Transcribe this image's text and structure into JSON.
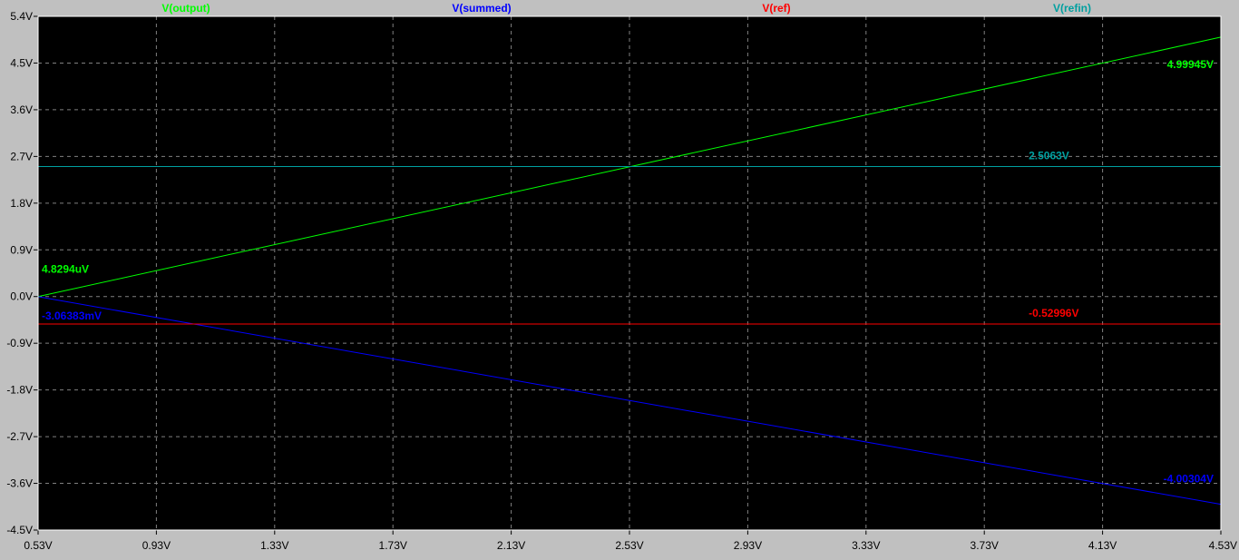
{
  "chart_data": {
    "type": "line",
    "xlabel": "",
    "ylabel": "",
    "xlim": [
      0.53,
      4.53
    ],
    "ylim": [
      -4.5,
      5.4
    ],
    "x_ticks": [
      "0.53V",
      "0.93V",
      "1.33V",
      "1.73V",
      "2.13V",
      "2.53V",
      "2.93V",
      "3.33V",
      "3.73V",
      "4.13V",
      "4.53V"
    ],
    "x_tick_values": [
      0.53,
      0.93,
      1.33,
      1.73,
      2.13,
      2.53,
      2.93,
      3.33,
      3.73,
      4.13,
      4.53
    ],
    "y_ticks": [
      "5.4V",
      "4.5V",
      "3.6V",
      "2.7V",
      "1.8V",
      "0.9V",
      "0.0V",
      "-0.9V",
      "-1.8V",
      "-2.7V",
      "-3.6V",
      "-4.5V"
    ],
    "y_tick_values": [
      5.4,
      4.5,
      3.6,
      2.7,
      1.8,
      0.9,
      0.0,
      -0.9,
      -1.8,
      -2.7,
      -3.6,
      -4.5
    ],
    "grid": true,
    "background": "#000000",
    "axis_color": "#c0c0c0",
    "tick_label_color": "#000000",
    "series": [
      {
        "name": "V(output)",
        "color": "#00ff00",
        "x": [
          0.53,
          4.53
        ],
        "y": [
          4.8294e-06,
          4.99945
        ],
        "labels": [
          {
            "text": "4.8294uV",
            "x": 0.53,
            "y": 4.8294e-06
          },
          {
            "text": "4.99945V",
            "x": 4.53,
            "y": 4.99945
          }
        ]
      },
      {
        "name": "V(summed)",
        "color": "#0000ff",
        "x": [
          0.53,
          4.53
        ],
        "y": [
          -0.00306383,
          -4.00304
        ],
        "labels": [
          {
            "text": "-3.06383mV",
            "x": 0.53,
            "y": -0.00306383
          },
          {
            "text": "-4.00304V",
            "x": 4.53,
            "y": -4.00304
          }
        ]
      },
      {
        "name": "V(ref)",
        "color": "#ff0000",
        "x": [
          0.53,
          4.53
        ],
        "y": [
          -0.52996,
          -0.52996
        ],
        "labels": [
          {
            "text": "-0.52996V",
            "x": 3.88,
            "y": -0.52996
          }
        ]
      },
      {
        "name": "V(refin)",
        "color": "#00a0a0",
        "x": [
          0.53,
          4.53
        ],
        "y": [
          2.5063,
          2.5063
        ],
        "labels": [
          {
            "text": "2.5063V",
            "x": 3.88,
            "y": 2.5063
          }
        ]
      }
    ]
  }
}
